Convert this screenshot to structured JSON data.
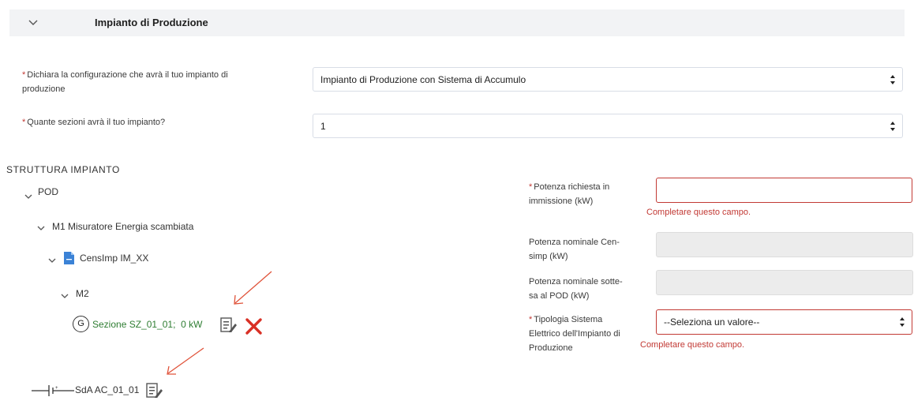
{
  "section": {
    "title": "Impianto di Produzione"
  },
  "config": {
    "label_line1": "Dichiara la configurazione che avrà il tuo impianto di",
    "label_line2": "produzione",
    "value": "Impianto di Produzione con Sistema di Accumulo"
  },
  "sezioni": {
    "label": "Quante sezioni avrà il tuo impianto?",
    "value": "1"
  },
  "structure": {
    "title": "STRUTTURA IMPIANTO",
    "pod": "POD",
    "m1": "M1 Misuratore Energia scambiata",
    "censimp": "CensImp IM_XX",
    "m2": "M2",
    "g_badge": "G",
    "sezione": "Sezione SZ_01_01;",
    "sezione_kw": "0 kW",
    "sda": "SdA AC_01_01"
  },
  "form": {
    "potenza_richiesta": {
      "label_line1": "Potenza richiesta in",
      "label_line2": "immissione (kW)",
      "value": "",
      "error": "Completare questo campo."
    },
    "potenza_censimp": {
      "label_line1": "Potenza nominale Cen-",
      "label_line2": "simp (kW)"
    },
    "potenza_pod": {
      "label_line1": "Potenza nominale sotte-",
      "label_line2": "sa al POD (kW)"
    },
    "tipologia": {
      "label_line1": "Tipologia Sistema",
      "label_line2": "Elettrico dell'Impianto di",
      "label_line3": "Produzione",
      "value": "--Seleziona un valore--",
      "error": "Completare questo campo."
    }
  },
  "colors": {
    "error": "#c23934",
    "success": "#2e7d32",
    "arrow": "#e0533a",
    "doc_icon": "#3b82d6"
  }
}
